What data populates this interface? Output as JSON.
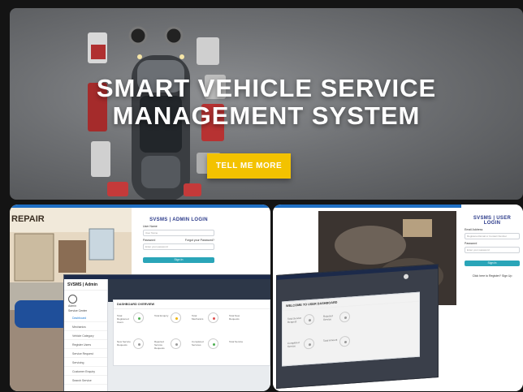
{
  "hero": {
    "title_line1": "SMART VEHICLE SERVICE",
    "title_line2": "MANAGEMENT SYSTEM",
    "cta_label": "TELL ME MORE"
  },
  "admin_login": {
    "title": "SVSMS | ADMIN LOGIN",
    "user_label": "User Name",
    "user_placeholder": "User Name",
    "password_label": "Password",
    "forgot_link": "Forgot your Password?",
    "password_placeholder": "Enter your password",
    "button": "Sign In"
  },
  "user_login": {
    "title": "SVSMS | USER LOGIN",
    "email_label": "Email Address",
    "email_placeholder": "Registered Email or Contact Number",
    "password_label": "Password",
    "password_placeholder": "Enter your password",
    "button": "Sign In",
    "footer": "Click here to Register? Sign Up"
  },
  "admin_dashboard": {
    "brand": "SVSMS | Admin",
    "user_name": "Admin",
    "user_role": "Service Center",
    "menu": [
      "Dashboard",
      "Mechanics",
      "Vehicle Category",
      "Register Users",
      "Service Request",
      "Servicing",
      "Customer Enquiry",
      "Search Service"
    ],
    "card_title": "DASHBOARD OVERVIEW",
    "tiles": [
      "Total Registered Users",
      "Total Enquiry",
      "Total Mechanics",
      "Total New Requests",
      "New Service Requests",
      "Rejected Service Requests",
      "Completed Services",
      "Total Service"
    ]
  },
  "user_dashboard": {
    "card_title": "WELCOME TO USER DASHBOARD",
    "tiles": [
      "Total Service Request",
      "Rejected Service",
      "Completed Service",
      "Total Amount"
    ]
  },
  "background_text": {
    "repair_sign": "REPAIR"
  },
  "colors": {
    "accent": "#f3c200",
    "login_button": "#2aa5b8",
    "login_title": "#2b3a8a",
    "dash_header": "#2d3748"
  }
}
